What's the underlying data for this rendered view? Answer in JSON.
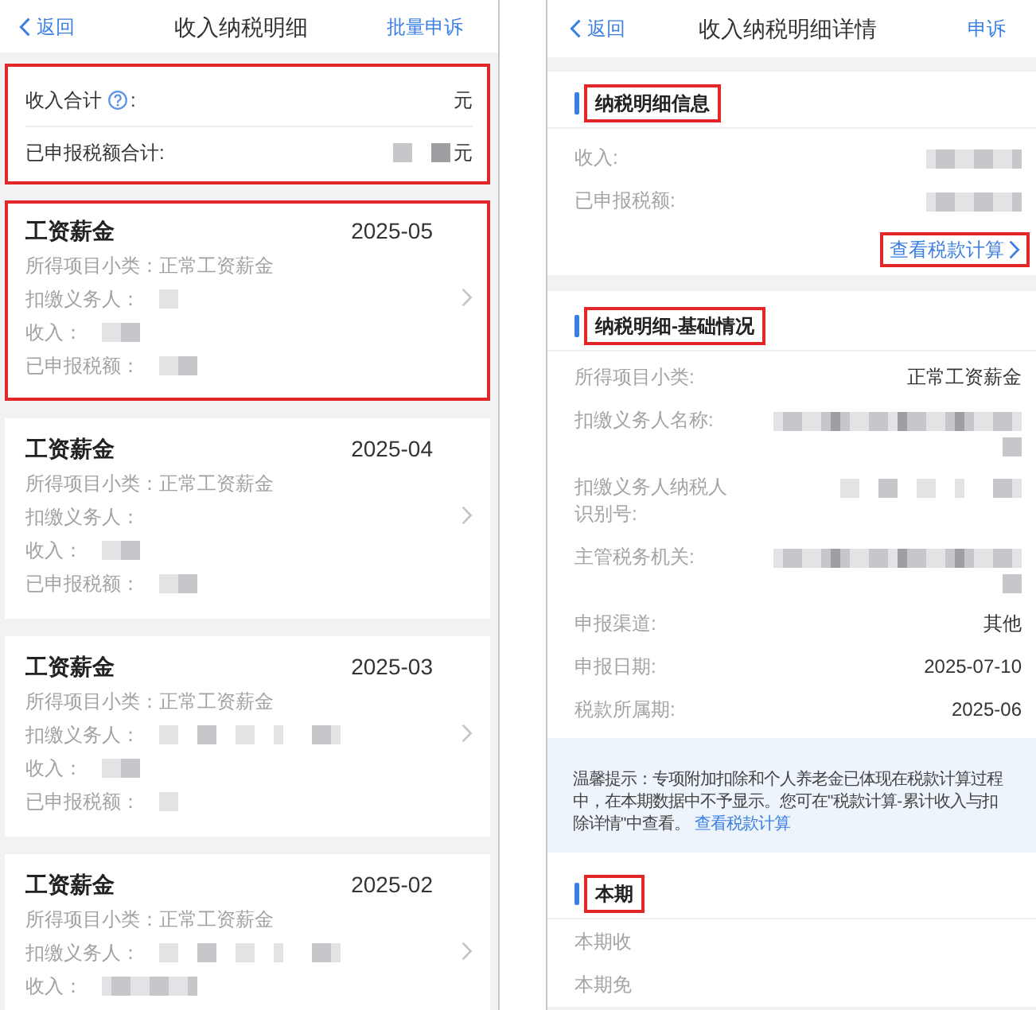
{
  "left_screen": {
    "nav": {
      "back": "返回",
      "title": "收入纳税明细",
      "action": "批量申诉"
    },
    "summary": {
      "highlighted": true,
      "rows": [
        {
          "label": "收入合计",
          "help": true,
          "label_suffix": ":",
          "kind": "plain",
          "unit": "元"
        },
        {
          "label": "已申报税额合计:",
          "help": false,
          "kind": "pair",
          "unit": "元"
        }
      ]
    },
    "records": [
      {
        "title": "工资薪金",
        "period": "2025-05",
        "highlighted": true,
        "fields": [
          {
            "label": "所得项目小类：",
            "value": "正常工资薪金",
            "kind": "plain"
          },
          {
            "label": "扣缴义务人：",
            "kind": "tiny"
          },
          {
            "label": "收入：",
            "kind": "short"
          },
          {
            "label": "已申报税额：",
            "kind": "short"
          }
        ]
      },
      {
        "title": "工资薪金",
        "period": "2025-04",
        "highlighted": false,
        "fields": [
          {
            "label": "所得项目小类：",
            "value": "正常工资薪金",
            "kind": "plain"
          },
          {
            "label": "扣缴义务人：",
            "kind": "plain"
          },
          {
            "label": "收入：",
            "kind": "short"
          },
          {
            "label": "已申报税额：",
            "kind": "short"
          }
        ]
      },
      {
        "title": "工资薪金",
        "period": "2025-03",
        "highlighted": false,
        "fields": [
          {
            "label": "所得项目小类：",
            "value": "正常工资薪金",
            "kind": "plain"
          },
          {
            "label": "扣缴义务人：",
            "kind": "long"
          },
          {
            "label": "收入：",
            "kind": "short"
          },
          {
            "label": "已申报税额：",
            "kind": "tiny"
          }
        ]
      },
      {
        "title": "工资薪金",
        "period": "2025-02",
        "highlighted": false,
        "fields": [
          {
            "label": "所得项目小类：",
            "value": "正常工资薪金",
            "kind": "plain"
          },
          {
            "label": "扣缴义务人：",
            "kind": "long"
          },
          {
            "label": "收入：",
            "kind": "medium"
          }
        ]
      }
    ]
  },
  "right_screen": {
    "nav": {
      "back": "返回",
      "title": "收入纳税明细详情",
      "action": "申诉"
    },
    "sections": [
      {
        "kind": "fields",
        "title": "纳税明细信息",
        "highlighted": true,
        "rows": [
          {
            "label": "收入:",
            "kind": "medium"
          },
          {
            "label": "已申报税额:",
            "kind": "medium"
          }
        ],
        "link": {
          "label": "查看税款计算",
          "highlighted": true
        }
      },
      {
        "kind": "fields",
        "title": "纳税明细-基础情况",
        "highlighted": true,
        "rows": [
          {
            "label": "所得项目小类:",
            "value": "正常工资薪金",
            "kind": "plain"
          },
          {
            "label": "扣缴义务人名称:",
            "kind": "twoline"
          },
          {
            "label": "扣缴义务人纳税人识别号:",
            "kind": "long"
          },
          {
            "label": "主管税务机关:",
            "kind": "twoline"
          },
          {
            "label": "申报渠道:",
            "value": "其他",
            "kind": "plain"
          },
          {
            "label": "申报日期:",
            "value": "2025-07-10",
            "kind": "plain"
          },
          {
            "label": "税款所属期:",
            "value": "2025-06",
            "kind": "plain"
          }
        ]
      },
      {
        "kind": "tip",
        "text": "温馨提示：专项附加扣除和个人养老金已体现在税款计算过程中，在本期数据中不予显示。您可在\"税款计算-累计收入与扣除详情\"中查看。",
        "link": "查看税款计算"
      },
      {
        "kind": "fields",
        "title": "本期",
        "highlighted": true,
        "rows": [
          {
            "label": "本期收",
            "kind": "plain"
          },
          {
            "label": "本期免",
            "kind": "plain"
          }
        ]
      }
    ]
  }
}
